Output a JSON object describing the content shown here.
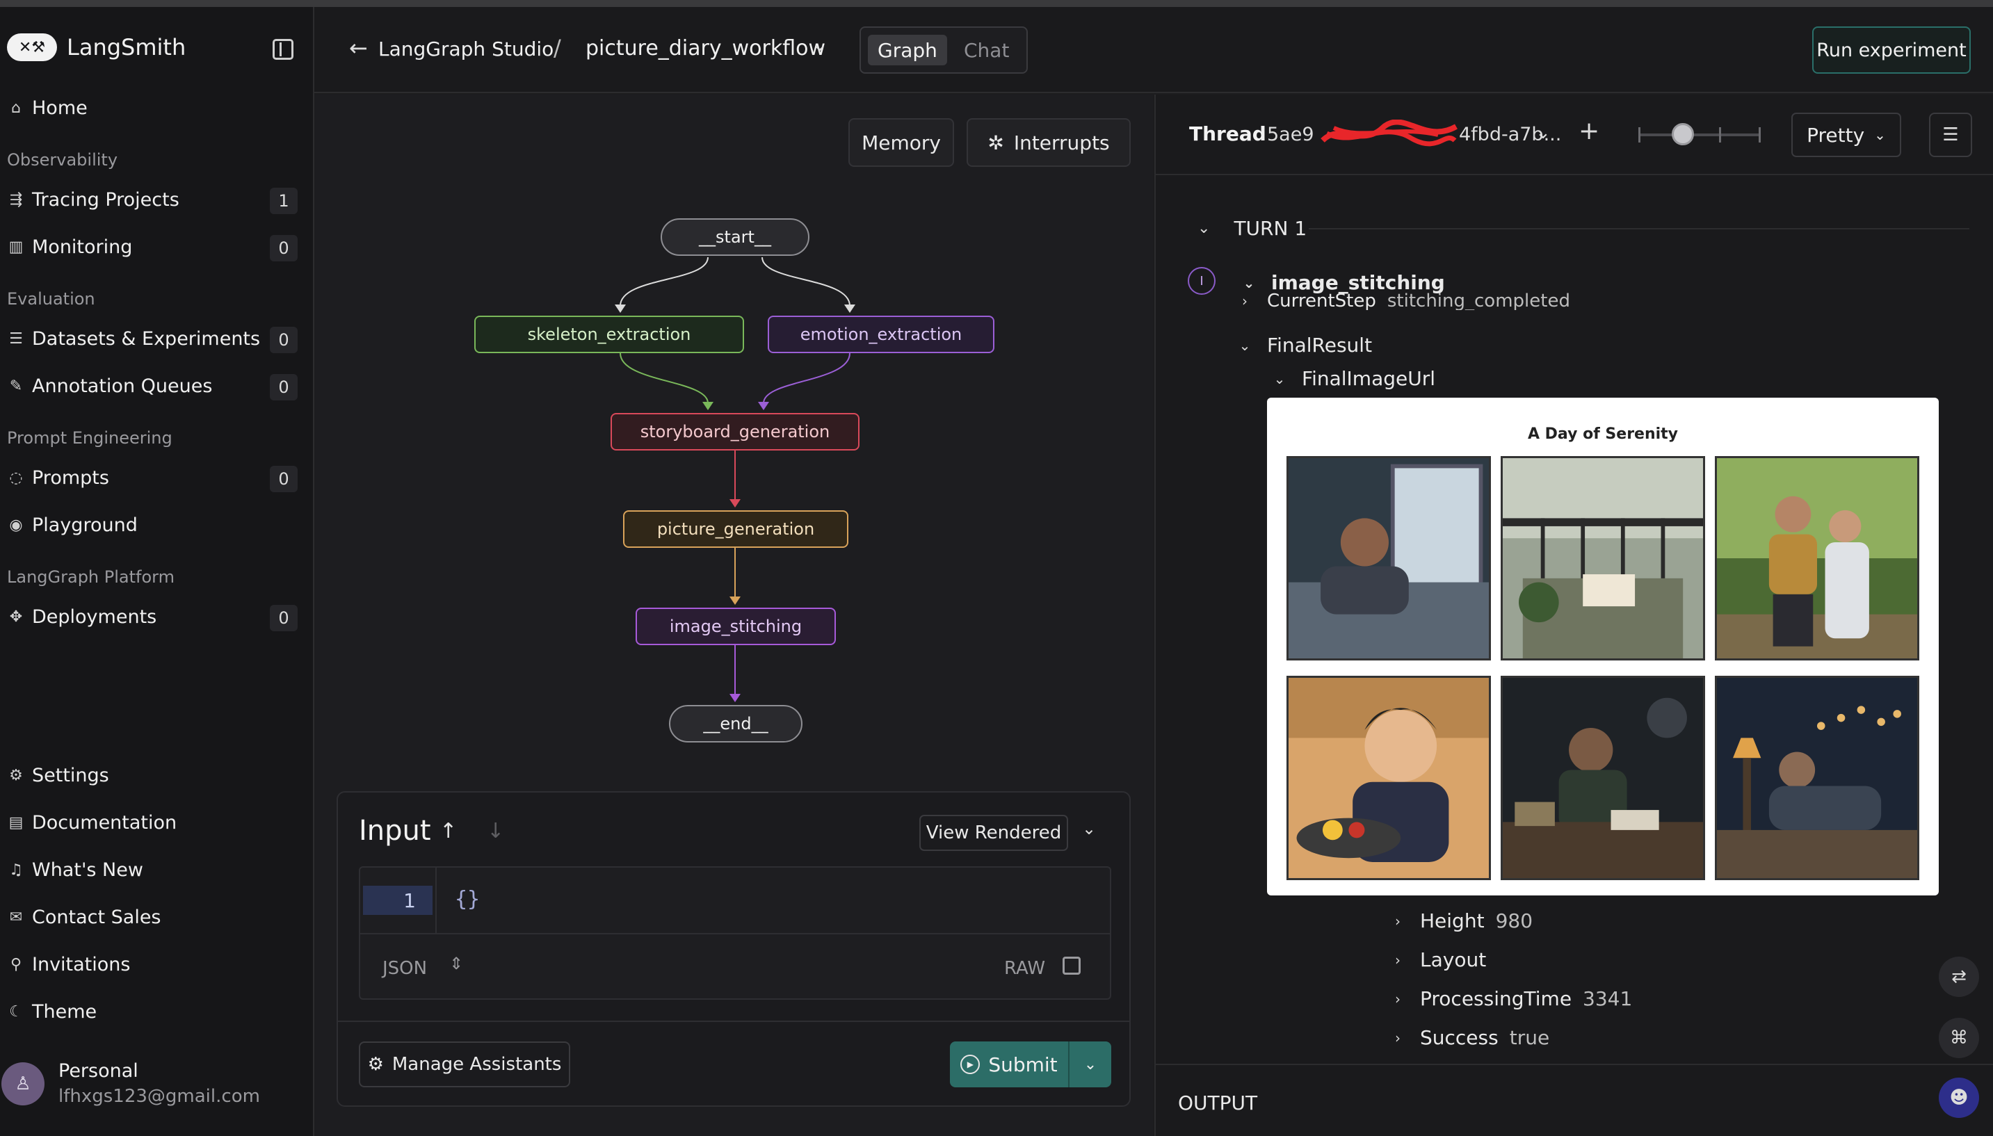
{
  "app": {
    "name": "LangSmith",
    "logo_letters": "✕⚒"
  },
  "sidebar": {
    "home": "Home",
    "observability": {
      "title": "Observability",
      "items": [
        {
          "label": "Tracing Projects",
          "count": "1"
        },
        {
          "label": "Monitoring",
          "count": "0"
        }
      ]
    },
    "evaluation": {
      "title": "Evaluation",
      "items": [
        {
          "label": "Datasets & Experiments",
          "count": "0"
        },
        {
          "label": "Annotation Queues",
          "count": "0"
        }
      ]
    },
    "prompt_engineering": {
      "title": "Prompt Engineering",
      "items": [
        {
          "label": "Prompts",
          "count": "0"
        },
        {
          "label": "Playground"
        }
      ]
    },
    "langgraph": {
      "title": "LangGraph Platform",
      "items": [
        {
          "label": "Deployments",
          "count": "0"
        }
      ]
    },
    "bottom": [
      {
        "label": "Settings"
      },
      {
        "label": "Documentation"
      },
      {
        "label": "What's New"
      },
      {
        "label": "Contact Sales"
      },
      {
        "label": "Invitations"
      },
      {
        "label": "Theme"
      }
    ],
    "user": {
      "name": "Personal",
      "email": "lfhxgs123@gmail.com"
    }
  },
  "header": {
    "back_label": "LangGraph Studio",
    "separator": "/",
    "workflow": "picture_diary_workflow",
    "tabs": [
      {
        "label": "Graph",
        "active": true
      },
      {
        "label": "Chat",
        "active": false
      }
    ],
    "run_button": "Run experiment"
  },
  "graph": {
    "memory_button": "Memory",
    "interrupts_button": "Interrupts",
    "nodes": [
      {
        "id": "start",
        "label": "__start__",
        "color": "#8e8e93"
      },
      {
        "id": "skeleton",
        "label": "skeleton_extraction",
        "color": "#7ab85a"
      },
      {
        "id": "emotion",
        "label": "emotion_extraction",
        "color": "#9b5fd6"
      },
      {
        "id": "storyboard",
        "label": "storyboard_generation",
        "color": "#d9495a"
      },
      {
        "id": "picture",
        "label": "picture_generation",
        "color": "#d9a35a"
      },
      {
        "id": "stitching",
        "label": "image_stitching",
        "color": "#a75ad9"
      },
      {
        "id": "end",
        "label": "__end__",
        "color": "#8e8e93"
      }
    ]
  },
  "input": {
    "title": "Input",
    "view_button": "View Rendered",
    "line_number": "1",
    "code": "{}",
    "format": "JSON",
    "raw": "RAW",
    "manage_button": "Manage Assistants",
    "submit_button": "Submit"
  },
  "thread": {
    "label": "Thread",
    "id_prefix": "5ae9",
    "id_suffix": "4fbd-a7b...",
    "format": "Pretty",
    "turn": "TURN 1",
    "step_badge": "I",
    "step_name": "image_stitching",
    "rows": [
      {
        "key": "CurrentStep",
        "value": "stitching_completed"
      },
      {
        "key": "FinalResult",
        "value": ""
      },
      {
        "key": "FinalImageUrl",
        "value": ""
      },
      {
        "key": "Height",
        "value": "980"
      },
      {
        "key": "Layout",
        "value": ""
      },
      {
        "key": "ProcessingTime",
        "value": "3341"
      },
      {
        "key": "Success",
        "value": "true"
      }
    ],
    "image_title": "A Day of Serenity",
    "output_label": "OUTPUT"
  }
}
